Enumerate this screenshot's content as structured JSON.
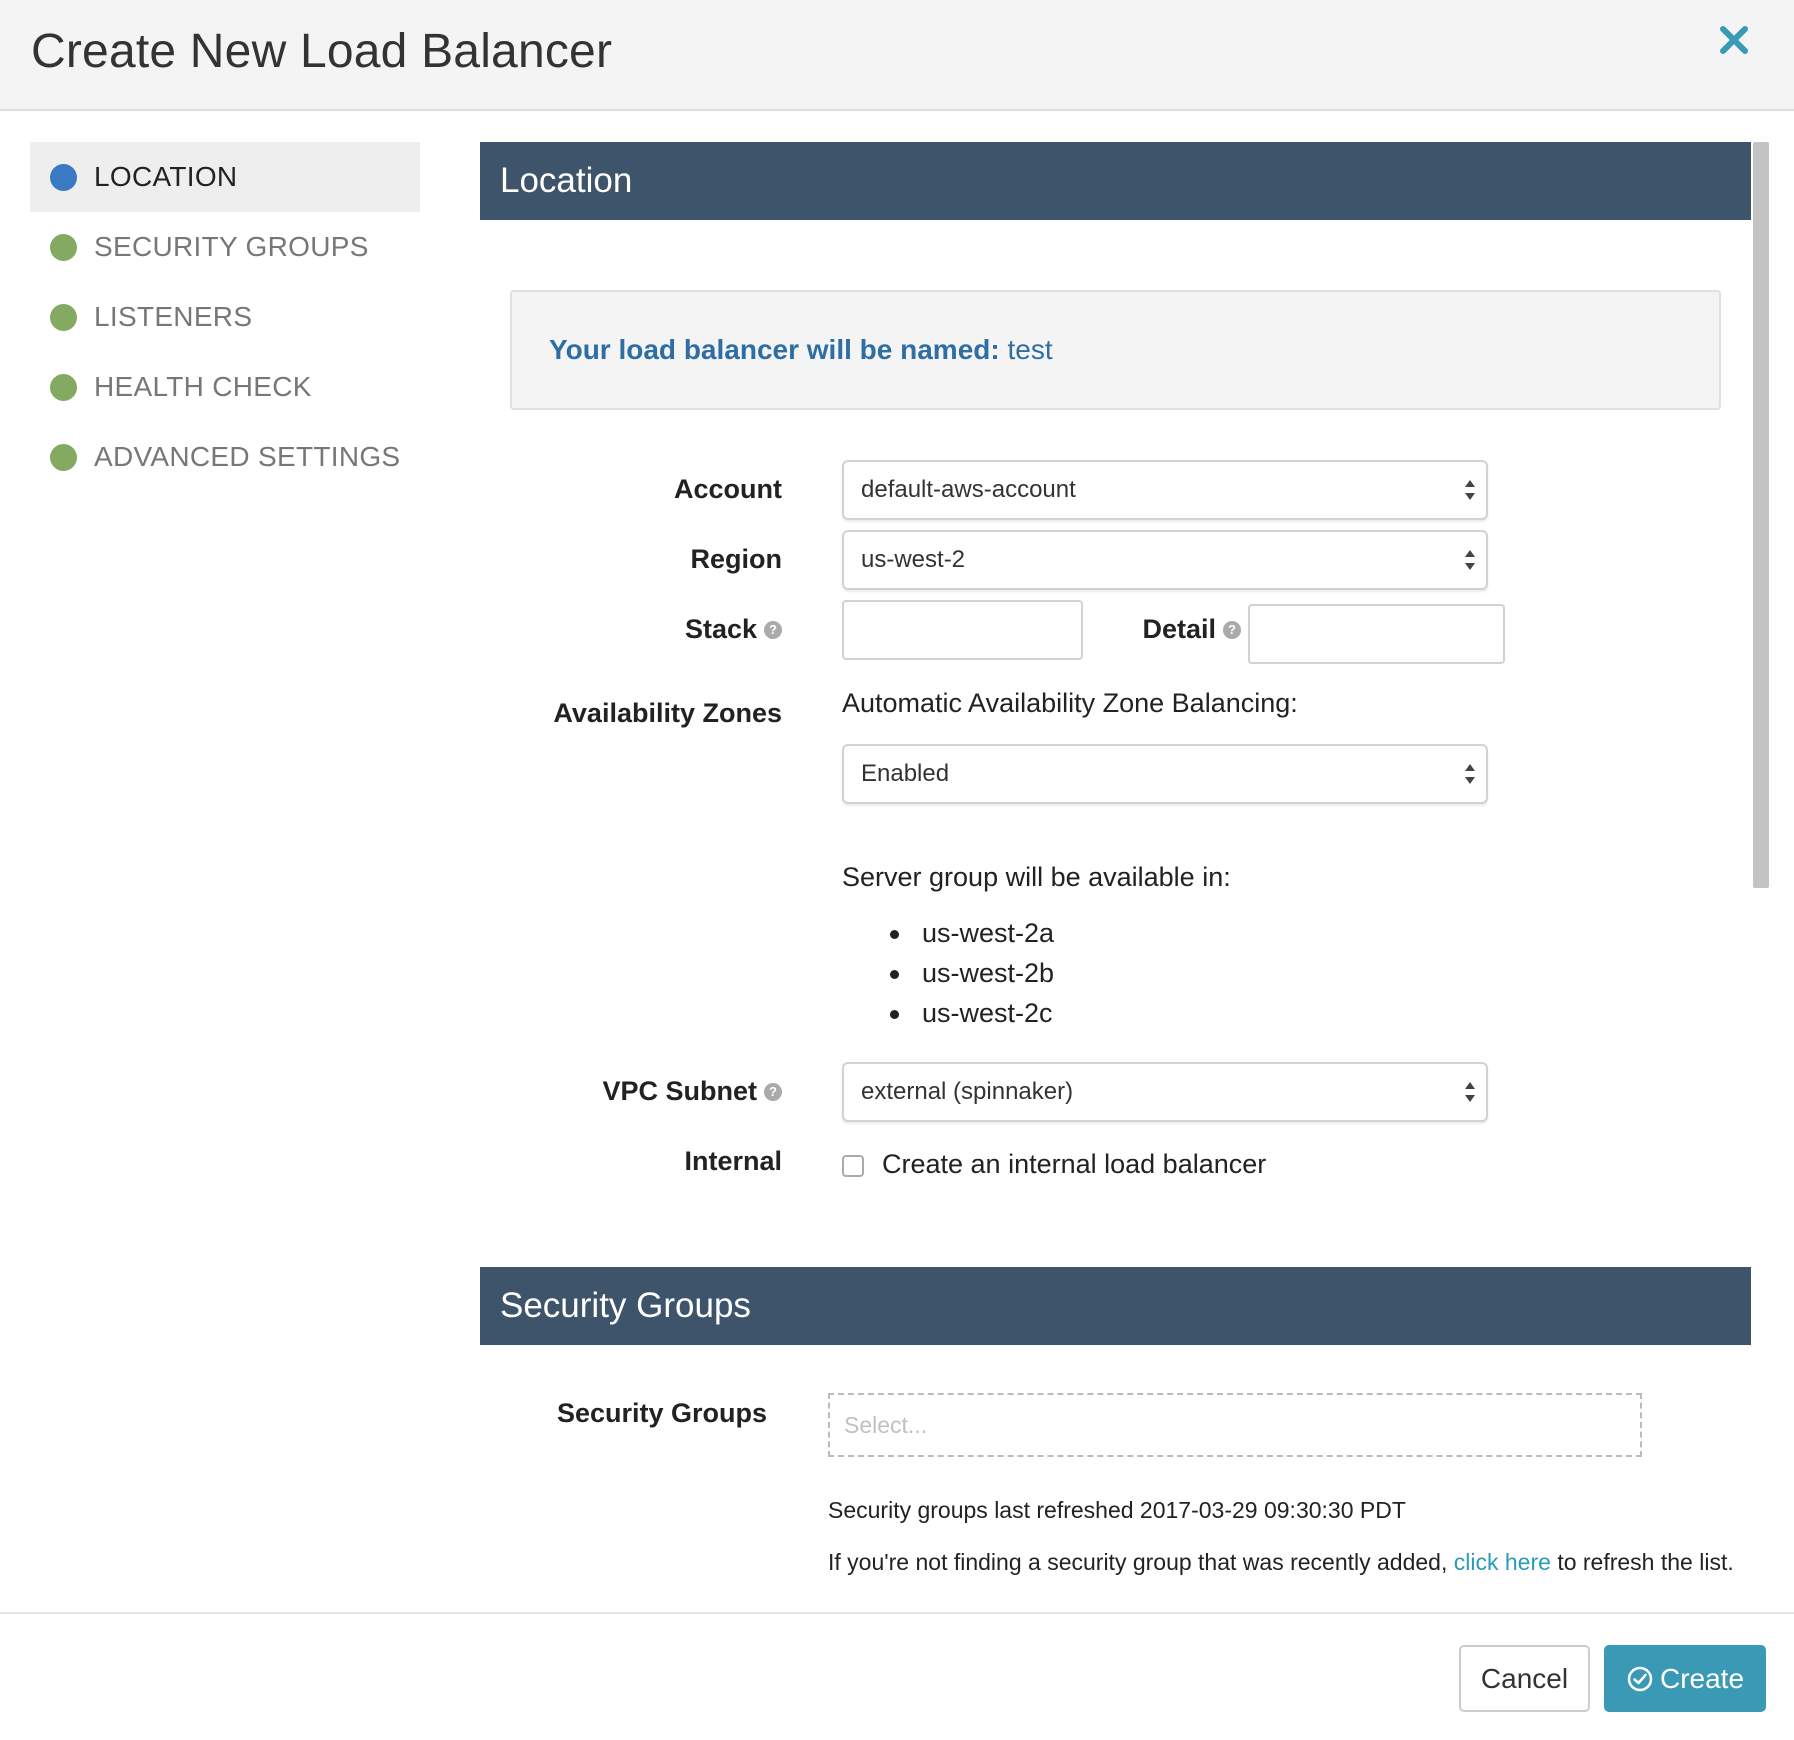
{
  "modal": {
    "title": "Create New Load Balancer",
    "close_icon": "close-icon"
  },
  "nav": {
    "items": [
      {
        "label": "LOCATION",
        "active": true
      },
      {
        "label": "SECURITY GROUPS",
        "active": false
      },
      {
        "label": "LISTENERS",
        "active": false
      },
      {
        "label": "HEALTH CHECK",
        "active": false
      },
      {
        "label": "ADVANCED SETTINGS",
        "active": false
      }
    ]
  },
  "location": {
    "header": "Location",
    "name_prefix": "Your load balancer will be named:",
    "name_value": "test",
    "account_label": "Account",
    "account_value": "default-aws-account",
    "region_label": "Region",
    "region_value": "us-west-2",
    "stack_label": "Stack",
    "stack_value": "",
    "detail_label": "Detail",
    "detail_value": "",
    "az_label": "Availability Zones",
    "az_balancing_label": "Automatic Availability Zone Balancing:",
    "az_balancing_value": "Enabled",
    "server_group_text": "Server group will be available in:",
    "zones": [
      "us-west-2a",
      "us-west-2b",
      "us-west-2c"
    ],
    "vpc_label": "VPC Subnet",
    "vpc_value": "external (spinnaker)",
    "internal_label": "Internal",
    "internal_checkbox_label": "Create an internal load balancer",
    "internal_checked": false
  },
  "security_groups": {
    "header": "Security Groups",
    "label": "Security Groups",
    "placeholder": "Select...",
    "refreshed_text": "Security groups last refreshed 2017-03-29 09:30:30 PDT",
    "hint_before": "If you're not finding a security group that was recently added,",
    "hint_link": "click here",
    "hint_after": "to refresh the list."
  },
  "footer": {
    "cancel_label": "Cancel",
    "create_label": "Create"
  },
  "colors": {
    "section_header": "#3e546b",
    "active_dot": "#3a7ac4",
    "done_dot": "#84a960",
    "primary_button": "#3a9ab5",
    "link": "#2a9bb8",
    "name_text": "#2f6ea3"
  }
}
